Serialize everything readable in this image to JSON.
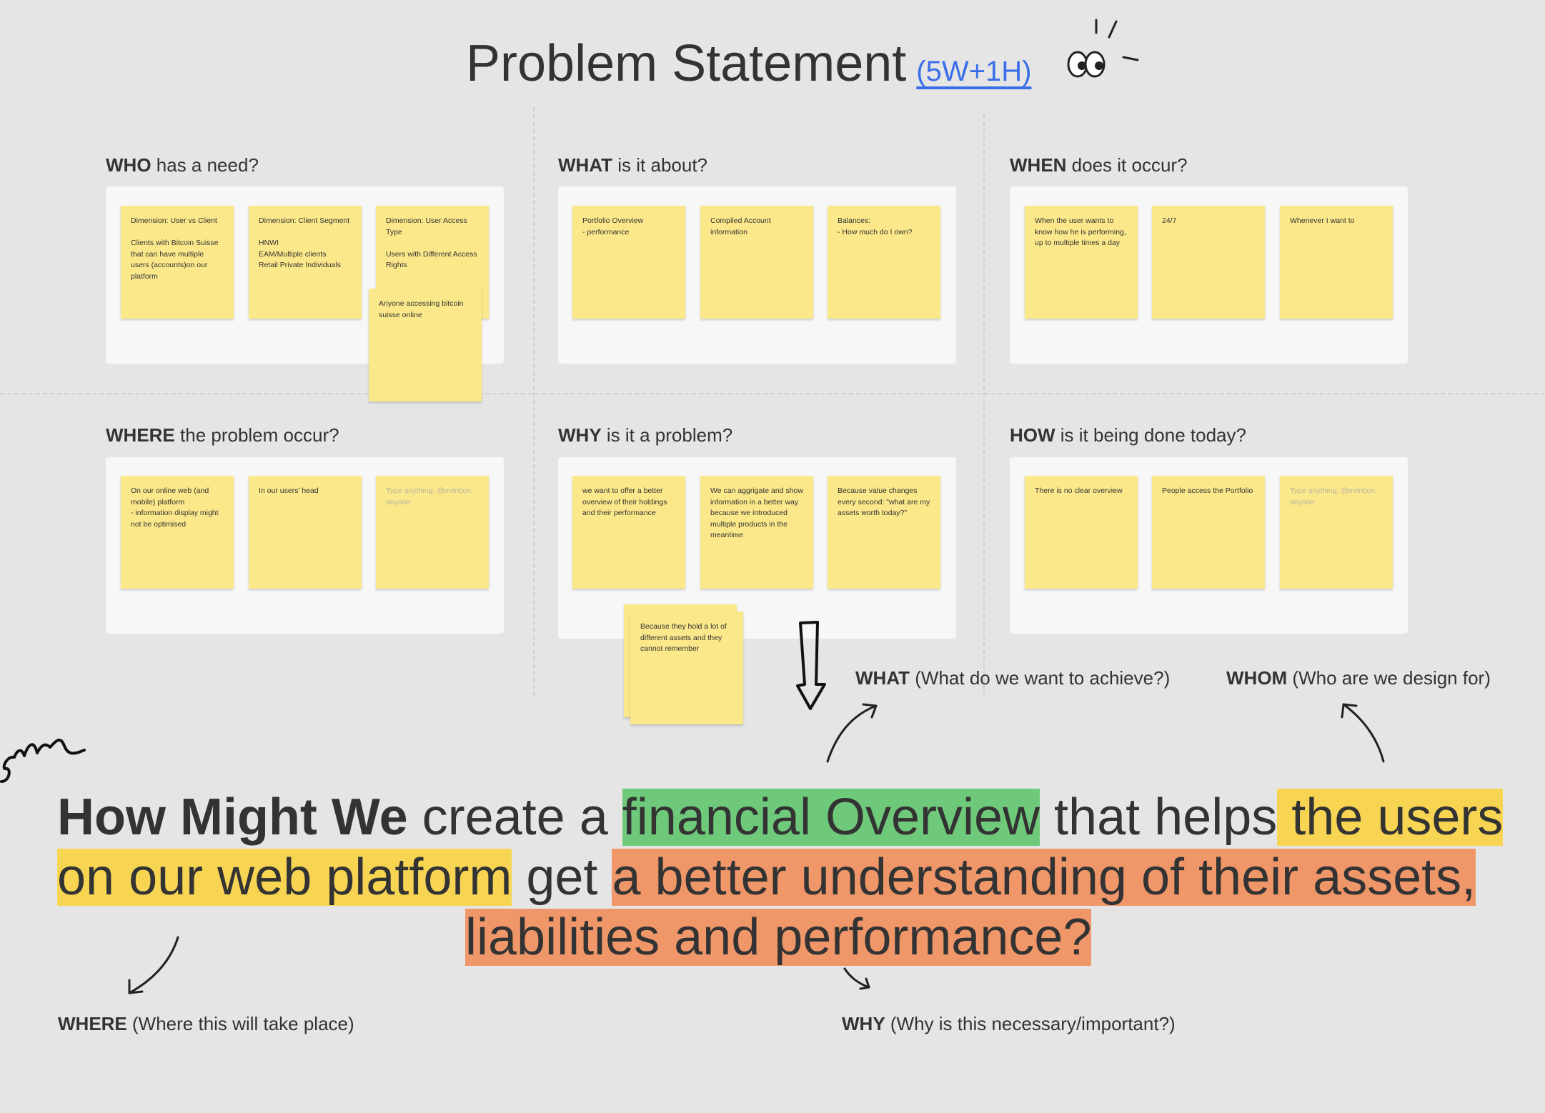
{
  "title": {
    "main": "Problem Statement",
    "link": "(5W+1H)"
  },
  "sections": {
    "who": {
      "key": "WHO",
      "rest": " has a need?"
    },
    "what": {
      "key": "WHAT",
      "rest": " is it about?"
    },
    "when": {
      "key": "WHEN",
      "rest": " does it occur?"
    },
    "where": {
      "key": "WHERE",
      "rest": " the problem occur?"
    },
    "why": {
      "key": "WHY",
      "rest": " is it a problem?"
    },
    "how": {
      "key": "HOW",
      "rest": " is it being done today?"
    }
  },
  "stickies": {
    "who": [
      "Dimension: User vs Client\n\nClients with Bitcoin Suisse that can have multiple users (accounts)on our platform",
      "Dimension: Client Segment\n\nHNWI\nEAM/Multiple clients\nRetail Private Individuals",
      "Dimension: User Access Type\n\nUsers with Different Access Rights",
      "Anyone accessing bitcoin suisse online"
    ],
    "what": [
      "Portfolio Overview\n- performance",
      "Compiled Account information",
      "Balances:\n- How much do I own?"
    ],
    "when": [
      "When the user wants to know how he is performing, up to multiple times a day",
      "24/7",
      "Whenever I want to"
    ],
    "where": [
      "On our online web (and mobile) platform\n- information display might not be optimised",
      "In our users' head",
      "Type anything, @mention anyone"
    ],
    "why": [
      "we want to offer a better overview of their holdings and their performance",
      "We can aggrigate and show information in a better way because we introduced multiple products in the meantime",
      "Because value changes every second: \"what are my assets worth today?\"",
      "Because they hold a lot of different assets and they cannot remember"
    ],
    "how": [
      "There is no clear overview",
      "People access the Portfolio",
      "Type anything, @mention anyone"
    ]
  },
  "annotations": {
    "what": {
      "key": "WHAT",
      "rest": " (What do we want to achieve?)"
    },
    "whom": {
      "key": "WHOM",
      "rest": " (Who are we design for)"
    },
    "where": {
      "key": "WHERE",
      "rest": " (Where this will take place)"
    },
    "why": {
      "key": "WHY",
      "rest": " (Why is this necessary/important?)"
    }
  },
  "hmw": {
    "bold": "How Might We",
    "t1": " create a ",
    "green": "financial Overview",
    "t2": " that helps",
    "yellow1": " the users ",
    "yellow2": " on our web platform",
    "t3": " get ",
    "orange1": "a better understanding of their assets,",
    "orange2": "liabilities and performance?"
  },
  "colors": {
    "background": "#e5e5e5",
    "sticky": "#fbe88a",
    "link": "#3a6ee8",
    "highlight_green": "#6fc97a",
    "highlight_yellow": "#f7d553",
    "highlight_orange": "#f0976a"
  },
  "icons": [
    "eyes-icon",
    "down-arrow-icon",
    "curved-arrow-icon",
    "scribble-icon"
  ]
}
